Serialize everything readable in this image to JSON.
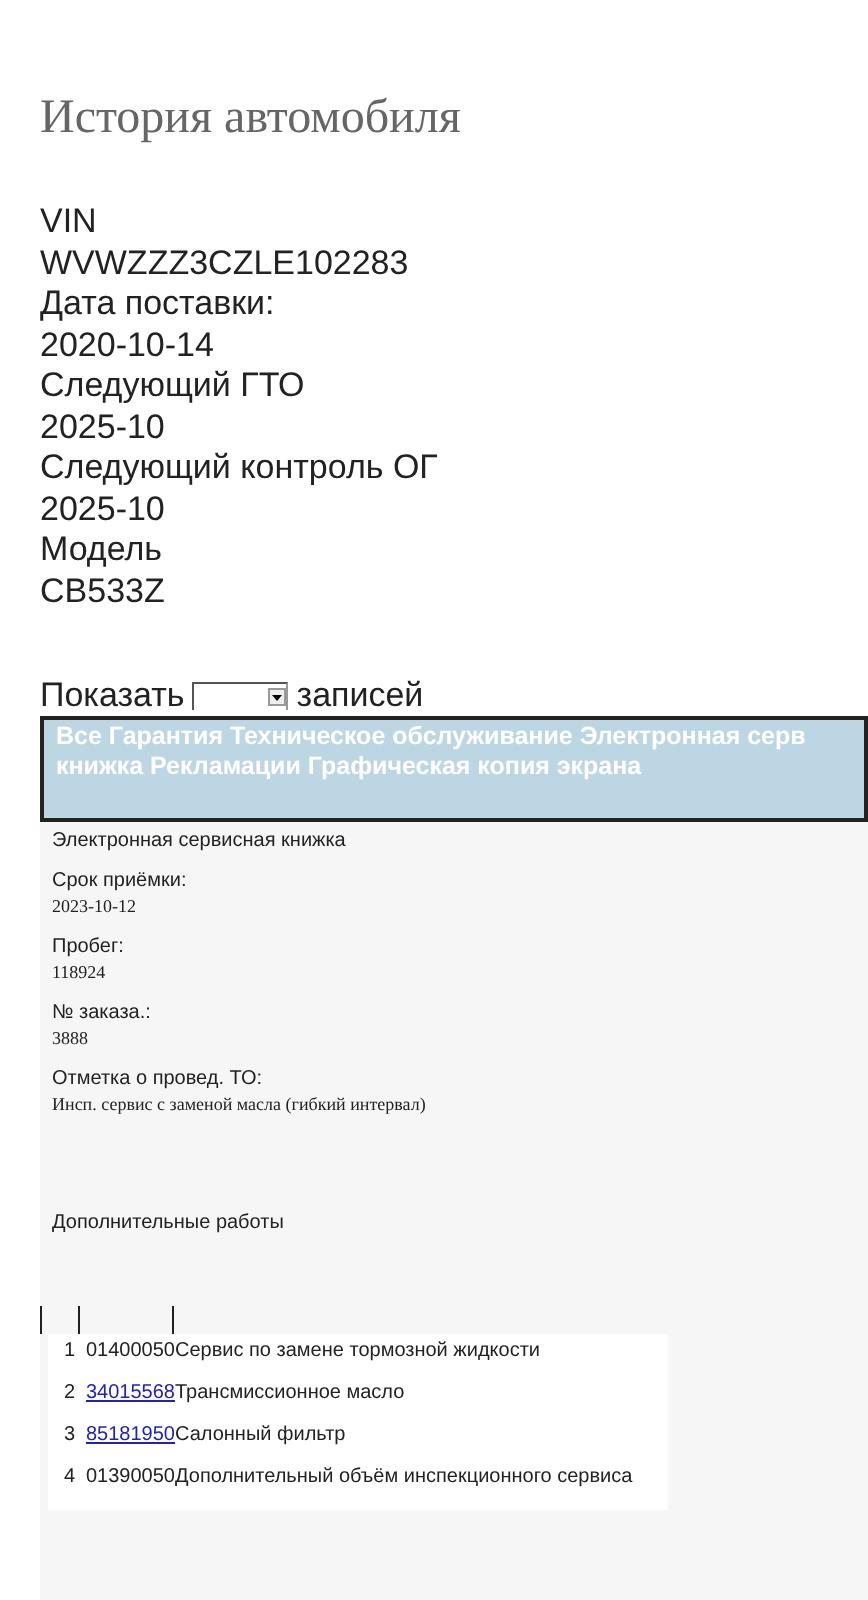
{
  "title": "История автомобиля",
  "details": [
    {
      "label": "VIN",
      "value": "WVWZZZ3CZLE102283"
    },
    {
      "label": "Дата поставки:",
      "value": "2020-10-14"
    },
    {
      "label": "Следующий ГТО",
      "value": "2025-10"
    },
    {
      "label": "Следующий контроль ОГ",
      "value": "2025-10"
    },
    {
      "label": "Модель",
      "value": "CB533Z"
    }
  ],
  "length_control": {
    "before": "Показать",
    "after": "записей"
  },
  "tab_bar": {
    "lines": [
      "Все Гарантия Техническое обслуживание Электронная серв",
      "книжка Рекламации Графическая копия экрана"
    ]
  },
  "record": {
    "heading": "Электронная сервисная книжка",
    "fields": [
      {
        "label": "Срок приёмки:",
        "value": "2023-10-12"
      },
      {
        "label": "Пробег:",
        "value": "118924"
      },
      {
        "label": "№ заказа.:",
        "value": "3888"
      },
      {
        "label": "Отметка о провед. ТО:",
        "value": "Инсп. сервис с заменой масла (гибкий интервал)"
      }
    ],
    "extra_heading": "Дополнительные работы",
    "works": [
      {
        "number": "1",
        "code": "01400050",
        "link": false,
        "name": "Сервис по замене тормозной жидкости"
      },
      {
        "number": "2",
        "code": "34015568",
        "link": true,
        "name": "Трансмиссионное масло"
      },
      {
        "number": "3",
        "code": "85181950",
        "link": true,
        "name": "Салонный фильтр"
      },
      {
        "number": "4",
        "code": "01390050",
        "link": false,
        "name": "Дополнительный объём инспекционного сервиса"
      }
    ]
  }
}
